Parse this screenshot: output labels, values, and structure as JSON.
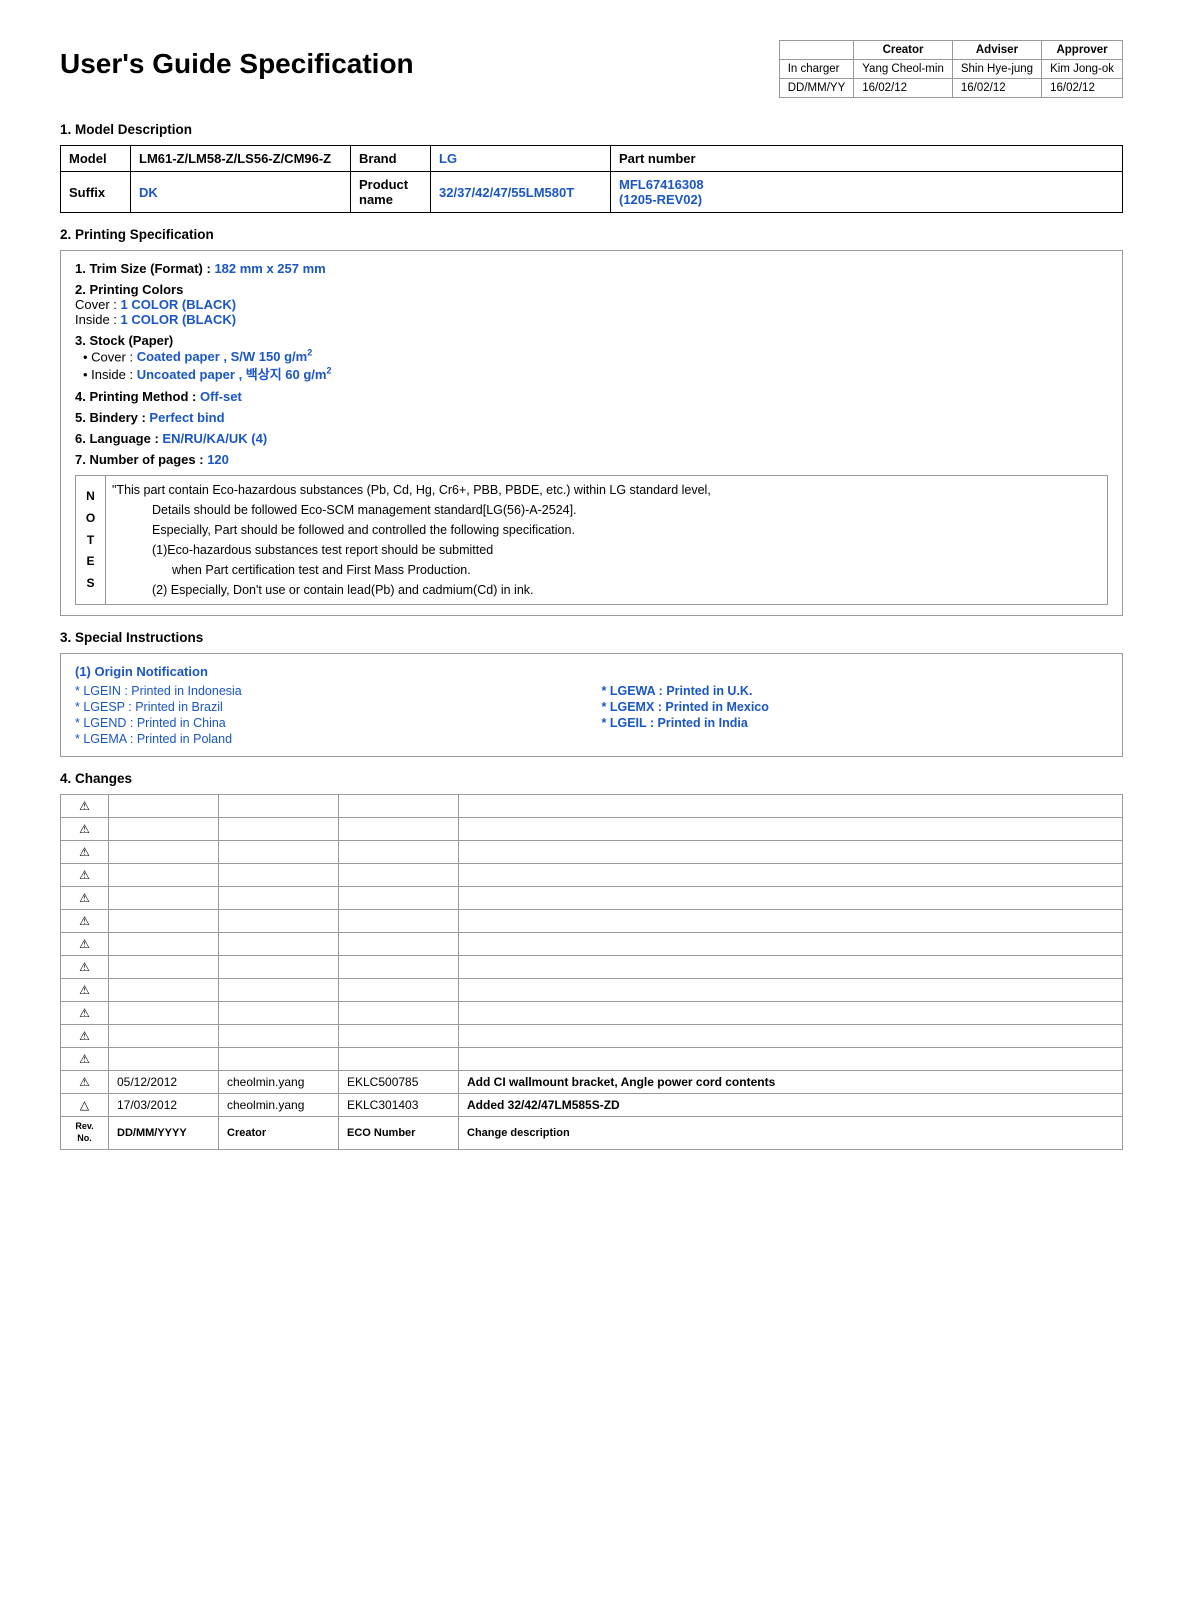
{
  "page": {
    "title": "User's Guide Specification"
  },
  "approval": {
    "headers": [
      "",
      "Creator",
      "Adviser",
      "Approver"
    ],
    "row1_label": "In charger",
    "row1_creator": "Yang Cheol-min",
    "row1_adviser": "Shin Hye-jung",
    "row1_approver": "Kim Jong-ok",
    "row2_label": "DD/MM/YY",
    "row2_creator": "16/02/12",
    "row2_adviser": "16/02/12",
    "row2_approver": "16/02/12"
  },
  "sections": {
    "model_description": "1. Model Description",
    "printing_specification": "2. Printing Specification",
    "special_instructions": "3. Special Instructions",
    "changes": "4. Changes"
  },
  "model_table": {
    "col1": "Model",
    "col1_val": "LM61-Z/LM58-Z/LS56-Z/CM96-Z",
    "col2": "Brand",
    "col2_val": "LG",
    "col3": "Part number",
    "col3_val": "MFL67416308\n(1205-REV02)",
    "row2_col1": "Suffix",
    "row2_col1_val": "DK",
    "row2_col2": "Product name",
    "row2_col2_val": "32/37/42/47/55LM580T"
  },
  "printing_spec": {
    "trim_size_label": "1. Trim Size (Format) :",
    "trim_size_val": "182 mm x 257 mm",
    "colors_label": "2. Printing Colors",
    "cover_label": "Cover :",
    "cover_val": "1 COLOR (BLACK)",
    "inside_label": "Inside :",
    "inside_val": "1 COLOR (BLACK)",
    "stock_label": "3. Stock (Paper)",
    "cover_stock_label": "Cover :",
    "cover_stock_val": "Coated paper , S/W 150 g/m",
    "inside_stock_label": "Inside :",
    "inside_stock_val": "Uncoated paper , 백상지 60 g/m",
    "method_label": "4. Printing Method :",
    "method_val": "Off-set",
    "bindery_label": "5. Bindery  :",
    "bindery_val": "Perfect bind",
    "language_label": "6. Language :",
    "language_val": "EN/RU/KA/UK (4)",
    "pages_label": "7. Number of pages :",
    "pages_val": "120"
  },
  "notes": {
    "label": "N\nO\nT\nE\nS",
    "line1": "\"This part contain Eco-hazardous substances (Pb, Cd, Hg, Cr6+, PBB, PBDE, etc.) within LG standard level,",
    "line2": "Details should be followed Eco-SCM management standard[LG(56)-A-2524].",
    "line3": "Especially, Part should be followed and controlled the following specification.",
    "line4": "(1)Eco-hazardous substances test report should be submitted",
    "line5": "when  Part certification test and First Mass Production.",
    "line6": "(2) Especially, Don't use or contain lead(Pb) and cadmium(Cd) in ink."
  },
  "origin_notification": {
    "title": "(1) Origin Notification",
    "origins": [
      {
        "left": "* LGEIN : Printed in Indonesia",
        "right": "* LGEWA : Printed in U.K."
      },
      {
        "left": "* LGESP : Printed in Brazil",
        "right": "* LGEMX : Printed in Mexico"
      },
      {
        "left": "* LGEND : Printed in China",
        "right": "* LGEIL : Printed in India"
      },
      {
        "left": "* LGEMA : Printed in Poland",
        "right": ""
      }
    ]
  },
  "changes_table": {
    "headers": [
      "Rev.\nNo.",
      "DD/MM/YYYY",
      "Creator",
      "ECO Number",
      "Change description"
    ],
    "empty_rows": 12,
    "data_rows": [
      {
        "rev": "⚠",
        "date": "05/12/2012",
        "creator": "cheolmin.yang",
        "eco": "EKLC500785",
        "desc": "Add CI wallmount bracket, Angle power cord contents"
      },
      {
        "rev": "△",
        "date": "17/03/2012",
        "creator": "cheolmin.yang",
        "eco": "EKLC301403",
        "desc": "Added 32/42/47LM585S-ZD"
      }
    ],
    "footer_row": {
      "rev": "Rev.\nNo.",
      "date": "DD/MM/YYYY",
      "creator": "Creator",
      "eco": "ECO Number",
      "desc": "Change description"
    }
  }
}
